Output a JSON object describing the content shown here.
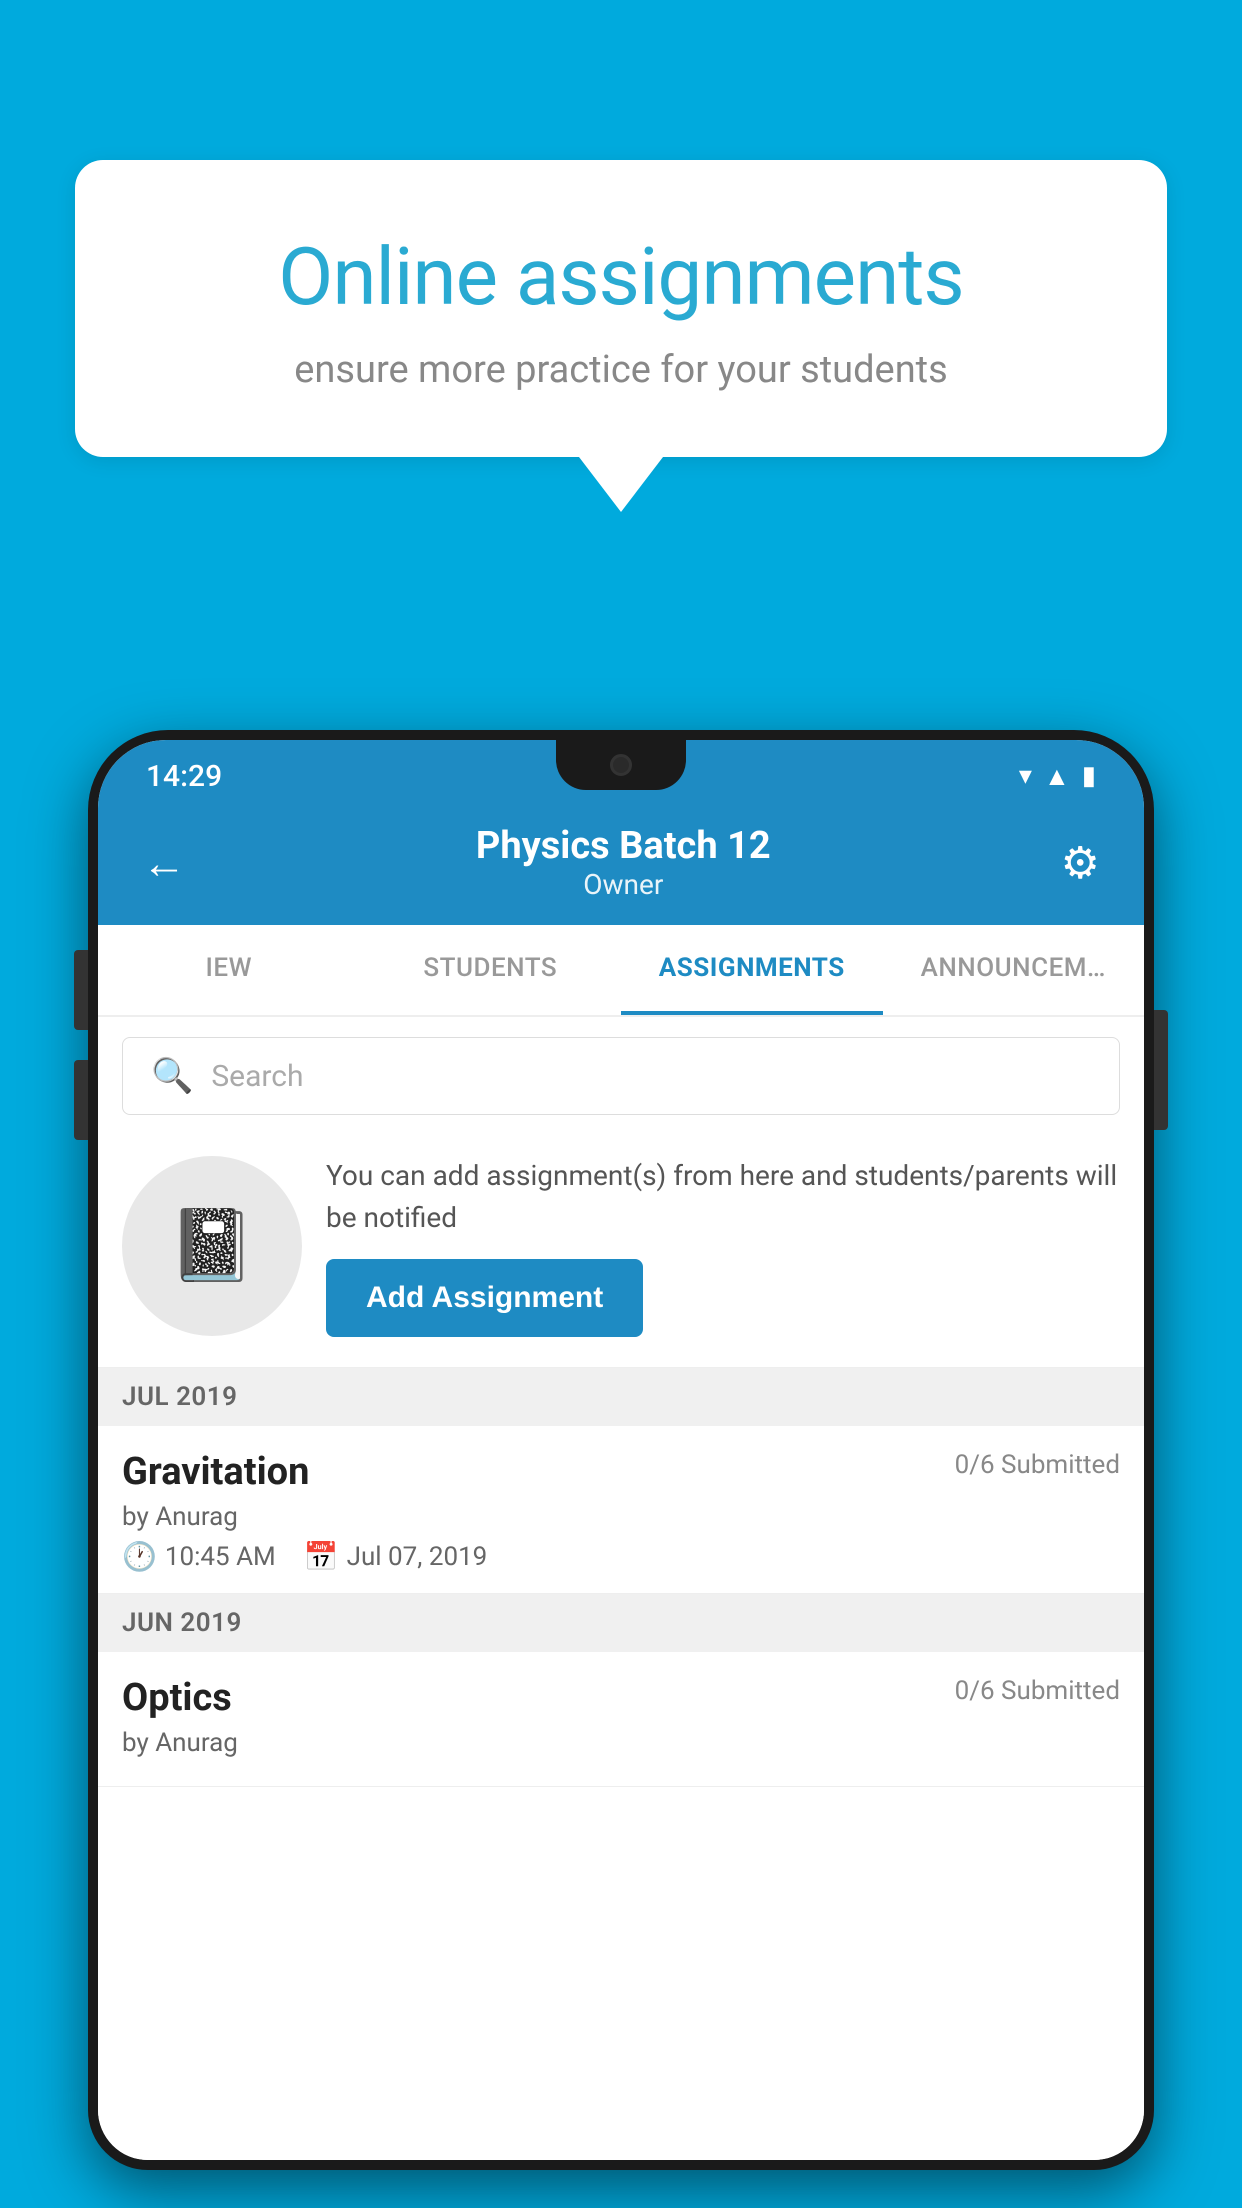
{
  "background_color": "#00AADD",
  "speech_bubble": {
    "title": "Online assignments",
    "subtitle": "ensure more practice for your students"
  },
  "status_bar": {
    "time": "14:29",
    "wifi_icon": "▾",
    "signal_icon": "▲",
    "battery_icon": "▮"
  },
  "header": {
    "title": "Physics Batch 12",
    "subtitle": "Owner",
    "back_label": "←",
    "gear_label": "⚙"
  },
  "tabs": [
    {
      "id": "view",
      "label": "IEW",
      "active": false
    },
    {
      "id": "students",
      "label": "STUDENTS",
      "active": false
    },
    {
      "id": "assignments",
      "label": "ASSIGNMENTS",
      "active": true
    },
    {
      "id": "announcements",
      "label": "ANNOUNCEM…",
      "active": false
    }
  ],
  "search": {
    "placeholder": "Search"
  },
  "promo": {
    "description": "You can add assignment(s) from here and students/parents will be notified",
    "button_label": "Add Assignment"
  },
  "sections": [
    {
      "month": "JUL 2019",
      "assignments": [
        {
          "name": "Gravitation",
          "submitted": "0/6 Submitted",
          "author": "by Anurag",
          "time": "10:45 AM",
          "date": "Jul 07, 2019"
        }
      ]
    },
    {
      "month": "JUN 2019",
      "assignments": [
        {
          "name": "Optics",
          "submitted": "0/6 Submitted",
          "author": "by Anurag",
          "time": "",
          "date": ""
        }
      ]
    }
  ]
}
